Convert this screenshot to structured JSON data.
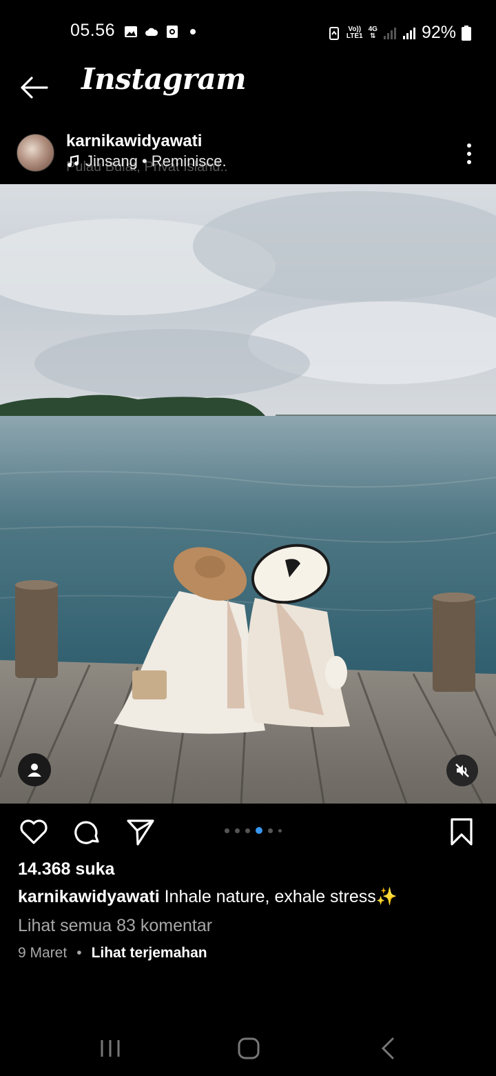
{
  "status_bar": {
    "time": "05.56",
    "battery": "92%",
    "network_top": "Vo))",
    "network_bottom": "LTE1",
    "network_gen": "4G",
    "icons_left": [
      "gallery-icon",
      "cloud-icon",
      "media-icon",
      "notification-dot"
    ],
    "icons_right": [
      "battery-saver-icon",
      "volte-icon",
      "4g-icon",
      "signal-icon",
      "signal-icon",
      "battery-icon"
    ]
  },
  "topbar": {
    "title": "Instagram"
  },
  "post": {
    "username": "karnikawidyawati",
    "location": "Pulau Bulat, Privat Island..",
    "music": "Jinsang • Reminisce.",
    "likes": "14.368 suka",
    "caption_user": "karnikawidyawati",
    "caption_text": " Inhale nature, exhale stress✨",
    "comments_link": "Lihat semua 83 komentar",
    "date": "9 Maret",
    "separator": "•",
    "translate": "Lihat terjemahan",
    "carousel": {
      "count": 6,
      "active_index": 3
    }
  },
  "colors": {
    "background": "#000000",
    "text": "#ffffff",
    "muted": "#a8a8a8",
    "accent": "#3797f0"
  }
}
